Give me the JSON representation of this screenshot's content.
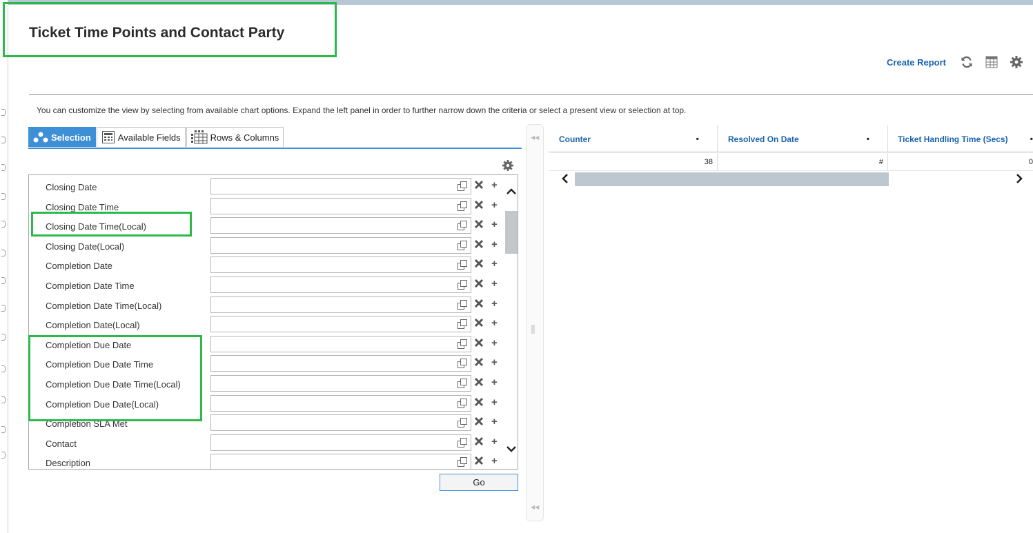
{
  "page": {
    "title": "Ticket Time Points and Contact Party",
    "hint": "You can customize the view by selecting from available chart options. Expand the left panel in order to further narrow down the criteria or select a present view or selection at top."
  },
  "toolbar": {
    "create_report": "Create Report",
    "icons": [
      "refresh-icon",
      "table-view-icon",
      "gear-icon"
    ]
  },
  "tabs": [
    {
      "label": "Selection",
      "icon": "selection-nodes-icon",
      "active": true
    },
    {
      "label": "Available Fields",
      "icon": "fields-list-icon",
      "active": false
    },
    {
      "label": "Rows & Columns",
      "icon": "grid-icon",
      "active": false
    }
  ],
  "fields": [
    {
      "label": "Closing Date",
      "value": ""
    },
    {
      "label": "Closing Date Time",
      "value": ""
    },
    {
      "label": "Closing Date Time(Local)",
      "value": ""
    },
    {
      "label": "Closing Date(Local)",
      "value": ""
    },
    {
      "label": "Completion Date",
      "value": ""
    },
    {
      "label": "Completion Date Time",
      "value": ""
    },
    {
      "label": "Completion Date Time(Local)",
      "value": ""
    },
    {
      "label": "Completion Date(Local)",
      "value": ""
    },
    {
      "label": "Completion Due Date",
      "value": ""
    },
    {
      "label": "Completion Due Date Time",
      "value": ""
    },
    {
      "label": "Completion Due Date Time(Local)",
      "value": ""
    },
    {
      "label": "Completion Due Date(Local)",
      "value": ""
    },
    {
      "label": "Completion SLA Met",
      "value": ""
    },
    {
      "label": "Contact",
      "value": ""
    },
    {
      "label": "Description",
      "value": ""
    }
  ],
  "go_button": "Go",
  "grid": {
    "columns": [
      {
        "label": "Counter",
        "marker": "▪"
      },
      {
        "label": "Resolved On Date",
        "marker": "▪"
      },
      {
        "label": "Ticket Handling Time (Secs)",
        "marker": "▪"
      }
    ],
    "rows": [
      [
        "38",
        "#",
        "0"
      ]
    ]
  },
  "colors": {
    "accent": "#3d8fd6",
    "link": "#1a63b0",
    "highlight": "#2db84b"
  }
}
